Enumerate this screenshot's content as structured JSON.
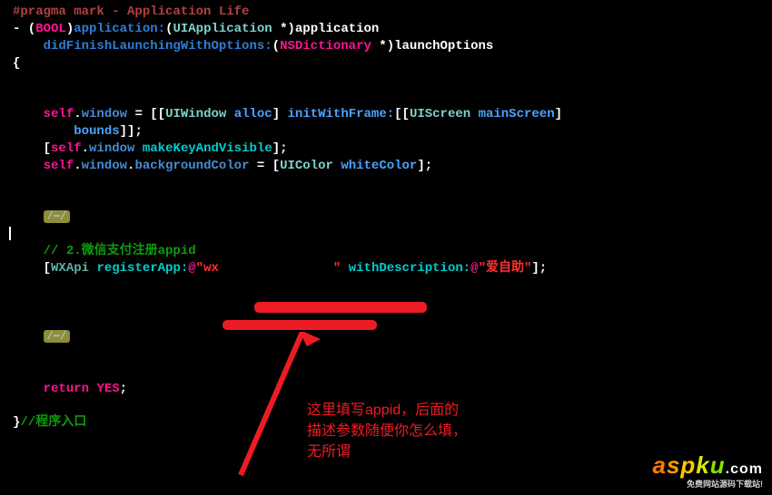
{
  "code": {
    "pragma": "#pragma mark - Application Life",
    "line2": {
      "dash": "- (",
      "bool": "BOOL",
      "paren": ")",
      "app1": "application:",
      "paren2": "(",
      "uiapp": "UIApplication",
      "star": " *)",
      "app2": "application"
    },
    "line3": {
      "indent": "    ",
      "did": "didFinishLaunchingWithOptions:",
      "paren": "(",
      "nsdict": "NSDictionary",
      "star": " *)",
      "launch": "launchOptions"
    },
    "brace_open": "{",
    "line6": {
      "indent": "    ",
      "self1": "self",
      "dot1": ".",
      "window1": "window",
      "eq": " = [[",
      "uiwindow": "UIWindow",
      "sp": " ",
      "alloc": "alloc",
      "br": "] ",
      "init": "initWithFrame:",
      "br2": "[[",
      "uiscreen": "UIScreen",
      "sp2": " ",
      "main": "mainScreen",
      "br3": "]"
    },
    "line7": {
      "indent": "        ",
      "bounds": "bounds",
      "end": "]];"
    },
    "line8": {
      "indent": "    [",
      "self": "self",
      "dot": ".",
      "window": "window",
      "sp": " ",
      "make": "makeKeyAndVisible",
      "end": "];"
    },
    "line9": {
      "indent": "    ",
      "self": "self",
      "dot1": ".",
      "window": "window",
      "dot2": ".",
      "bg": "backgroundColor",
      "eq": " = [",
      "uicolor": "UIColor",
      "sp": " ",
      "white": "whiteColor",
      "end": "];"
    },
    "fold": "/⋯/",
    "comment2": "// 2.微信支付注册appid",
    "line_wx": {
      "indent": "    [",
      "wxapi": "WXApi",
      "sp": " ",
      "reg": "registerApp:",
      "at1": "@",
      "str1": "\"wx",
      "str1end": "\"",
      "sp2": " ",
      "with": "withDescription:",
      "at2": "@",
      "str2": "\"爱自助\"",
      "end": "];"
    },
    "line_ret": {
      "indent": "    ",
      "return": "return",
      "sp": " ",
      "yes": "YES",
      "semi": ";"
    },
    "brace_close": "}",
    "comment_entry": "//程序入口"
  },
  "annotation": {
    "l1": "这里填写appid，后面的",
    "l2": "描述参数随便你怎么填，",
    "l3": "无所谓"
  },
  "watermark": {
    "brand": "aspku",
    "dotcom": ".com",
    "sub": "免费网站源码下载站!"
  }
}
